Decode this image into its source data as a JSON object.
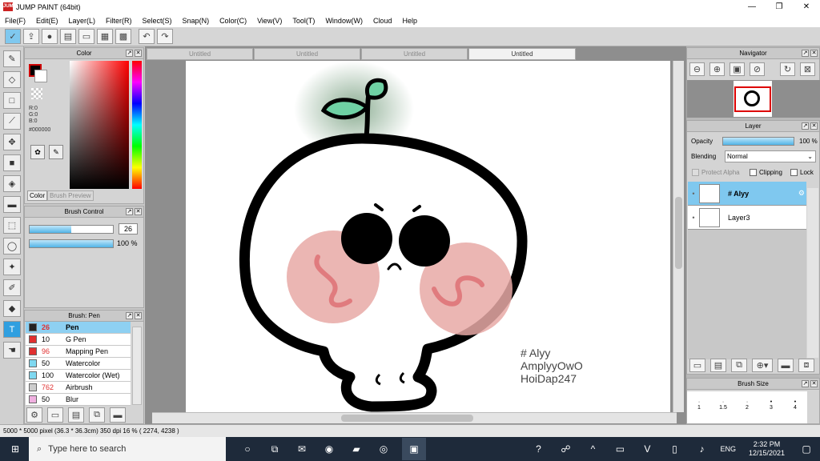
{
  "window": {
    "title": "JUMP PAINT (64bit)",
    "app_icon": "JUMP"
  },
  "menu": [
    "File(F)",
    "Edit(E)",
    "Layer(L)",
    "Filter(R)",
    "Select(S)",
    "Snap(N)",
    "Color(C)",
    "View(V)",
    "Tool(T)",
    "Window(W)",
    "Cloud",
    "Help"
  ],
  "doc_tabs": [
    "Untitled",
    "Untitled",
    "Untitled",
    "Untitled"
  ],
  "color_panel": {
    "title": "Color",
    "r": "R:0",
    "g": "G:0",
    "b": "B:0",
    "hex": "#000000",
    "tab1": "Color",
    "tab2": "Brush Preview"
  },
  "brush_control": {
    "title": "Brush Control",
    "size": "26",
    "opacity": "100 %",
    "size_level": 0.5,
    "opacity_level": 1.0
  },
  "brush_list": {
    "title": "Brush: Pen",
    "items": [
      {
        "size": "26",
        "name": "Pen",
        "color": "#222222",
        "sel": true
      },
      {
        "size": "10",
        "name": "G Pen",
        "color": "#e03030",
        "sel": false
      },
      {
        "size": "96",
        "name": "Mapping Pen",
        "color": "#e03030",
        "sel": false
      },
      {
        "size": "50",
        "name": "Watercolor",
        "color": "#7fd8f0",
        "sel": false
      },
      {
        "size": "100",
        "name": "Watercolor (Wet)",
        "color": "#7fd8f0",
        "sel": false
      },
      {
        "size": "762",
        "name": "Airbrush",
        "color": "#cccccc",
        "sel": false
      },
      {
        "size": "50",
        "name": "Blur",
        "color": "#f0b0e0",
        "sel": false
      }
    ]
  },
  "canvas_text": {
    "line1": "# Alyy",
    "line2": "AmplyyOwO",
    "line3": "HoiDap247"
  },
  "status": {
    "text": "5000 * 5000 pixel   (36.3 * 36.3cm)   350 dpi   16 %   ( 2274, 4238 )"
  },
  "navigator": {
    "title": "Navigator"
  },
  "layer_panel": {
    "title": "Layer",
    "opacity_label": "Opacity",
    "opacity_value": "100 %",
    "blending_label": "Blending",
    "blending_value": "Normal",
    "protect_alpha": "Protect Alpha",
    "clipping": "Clipping",
    "lock": "Lock",
    "layers": [
      {
        "name": "# Alyy",
        "sel": true
      },
      {
        "name": "Layer3",
        "sel": false
      }
    ]
  },
  "brush_size": {
    "title": "Brush Size",
    "values": [
      "1",
      "1.5",
      "2",
      "3",
      "4"
    ]
  },
  "taskbar": {
    "search": "Type here to search",
    "time": "2:32 PM",
    "date": "12/15/2021",
    "lang": "ENG"
  }
}
